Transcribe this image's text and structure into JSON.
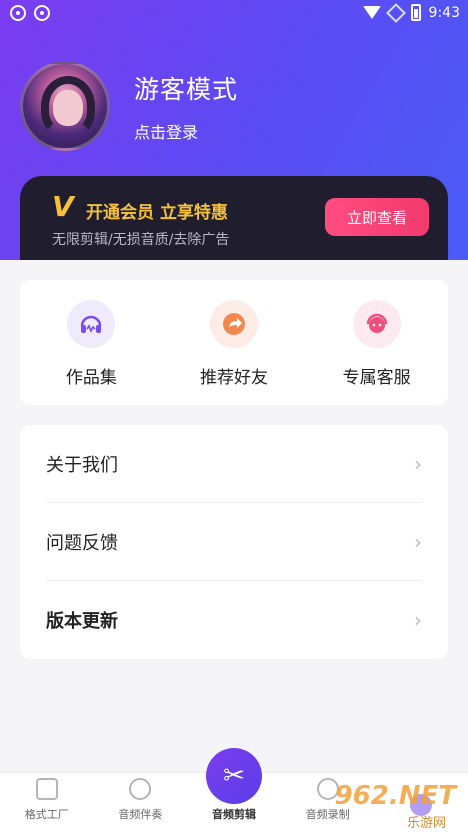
{
  "status_bar": {
    "time": "9:43"
  },
  "profile": {
    "title": "游客模式",
    "login_text": "点击登录"
  },
  "vip": {
    "badge": "V",
    "title": "开通会员 立享特惠",
    "subtitle": "无限剪辑/无损音质/去除广告",
    "button_label": "立即查看"
  },
  "features": [
    {
      "label": "作品集",
      "icon": "headphones-icon"
    },
    {
      "label": "推荐好友",
      "icon": "share-arrow-icon"
    },
    {
      "label": "专属客服",
      "icon": "customer-service-icon"
    }
  ],
  "menu": [
    {
      "label": "关于我们"
    },
    {
      "label": "问题反馈"
    },
    {
      "label": "版本更新"
    }
  ],
  "tabs": [
    {
      "label": "格式工厂",
      "icon": "paint-roller-icon"
    },
    {
      "label": "音频伴奏",
      "icon": "disc-icon"
    },
    {
      "label": "音频剪辑",
      "icon": "scissors-icon"
    },
    {
      "label": "音频录制",
      "icon": "microphone-icon"
    },
    {
      "label": "",
      "icon": "profile-icon"
    }
  ],
  "watermark": {
    "text": "962.NET",
    "sub": "乐游网"
  }
}
